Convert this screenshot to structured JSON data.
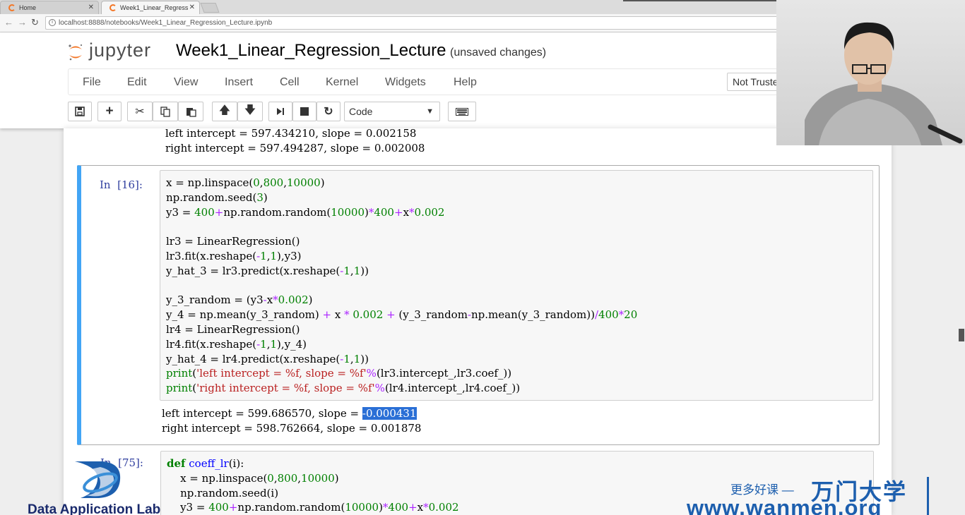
{
  "browser": {
    "tabs": [
      {
        "label": "Home",
        "active": false
      },
      {
        "label": "Week1_Linear_Regress",
        "active": true
      }
    ],
    "url": "localhost:8888/notebooks/Week1_Linear_Regression_Lecture.ipynb"
  },
  "header": {
    "logo_text": "jupyter",
    "notebook_title": "Week1_Linear_Regression_Lecture",
    "save_status": "(unsaved changes)",
    "trust_label": "Not Truste"
  },
  "menu": [
    "File",
    "Edit",
    "View",
    "Insert",
    "Cell",
    "Kernel",
    "Widgets",
    "Help"
  ],
  "toolbar": {
    "buttons": [
      "save-icon",
      "plus-icon",
      "cut-icon",
      "copy-icon",
      "paste-icon",
      "arrow-up-icon",
      "arrow-down-icon",
      "step-forward-icon",
      "stop-icon",
      "restart-icon",
      "keyboard-icon"
    ],
    "cell_type": "Code"
  },
  "previous_output": [
    "left intercept = 597.434210, slope = 0.002158",
    "right intercept = 597.494287, slope = 0.002008"
  ],
  "cells": [
    {
      "prompt": "In  [16]:",
      "output": {
        "line1_prefix": "left intercept = 599.686570, slope = ",
        "line1_selected": "-0.000431",
        "line2": "right intercept = 598.762664, slope = 0.001878"
      }
    },
    {
      "prompt": "In  [75]:"
    }
  ],
  "watermarks": {
    "left_brand": "Data Application Lab",
    "right_cn_small": "更多好课 —",
    "right_cn_big": "万门大学",
    "right_url": "www.wanmen.org"
  },
  "colors": {
    "selected_cell_border": "#42a5f5",
    "prompt": "#303f9f",
    "keyword": "#008000",
    "operator": "#aa22ff",
    "string": "#ba2121",
    "function_name": "#0000ff",
    "brand_blue": "#1d5fae"
  }
}
